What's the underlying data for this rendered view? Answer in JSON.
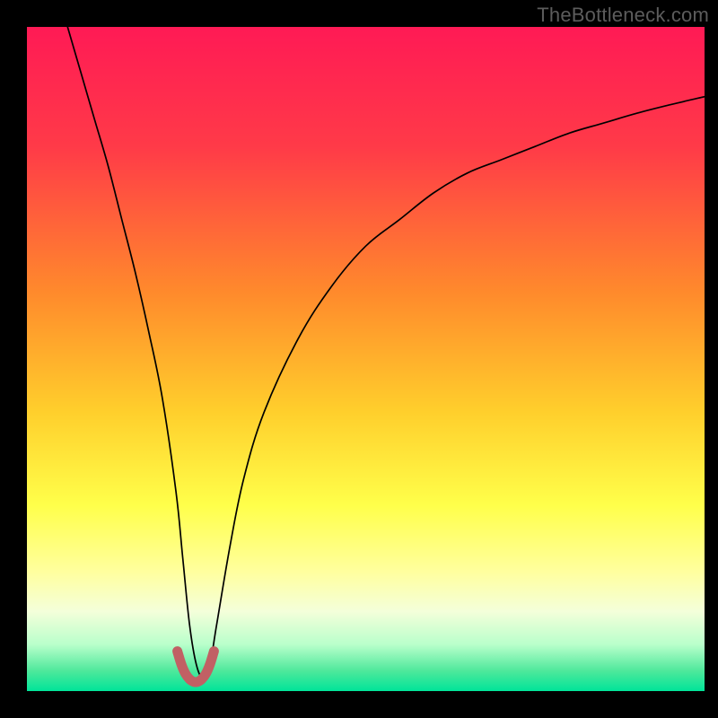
{
  "watermark": "TheBottleneck.com",
  "chart_data": {
    "type": "line",
    "title": "",
    "xlabel": "",
    "ylabel": "",
    "xlim": [
      0,
      100
    ],
    "ylim": [
      0,
      100
    ],
    "gradient_stops": [
      {
        "offset": 0,
        "color": "#ff1a55"
      },
      {
        "offset": 18,
        "color": "#ff3a48"
      },
      {
        "offset": 40,
        "color": "#ff8a2c"
      },
      {
        "offset": 58,
        "color": "#ffcf2c"
      },
      {
        "offset": 72,
        "color": "#ffff4a"
      },
      {
        "offset": 82,
        "color": "#ffff9e"
      },
      {
        "offset": 88,
        "color": "#f4ffda"
      },
      {
        "offset": 93,
        "color": "#b9ffcb"
      },
      {
        "offset": 97,
        "color": "#4de89b"
      },
      {
        "offset": 100,
        "color": "#00e499"
      }
    ],
    "series": [
      {
        "name": "bottleneck-curve",
        "color": "#000000",
        "stroke_width": 1.7,
        "x": [
          6,
          8,
          10,
          12,
          14,
          16,
          18,
          20,
          22,
          23,
          24,
          25,
          26,
          27,
          28,
          30,
          32,
          35,
          40,
          45,
          50,
          55,
          60,
          65,
          70,
          75,
          80,
          85,
          90,
          95,
          100
        ],
        "values": [
          100,
          93,
          86,
          79,
          71,
          63,
          54,
          44,
          30,
          20,
          10,
          4,
          2,
          4,
          10,
          22,
          32,
          42,
          53,
          61,
          67,
          71,
          75,
          78,
          80,
          82,
          84,
          85.5,
          87,
          88.3,
          89.5
        ]
      },
      {
        "name": "highlight-band",
        "color": "#c16064",
        "stroke_width": 11,
        "x": [
          22.2,
          22.8,
          23.4,
          24.0,
          24.6,
          25.2,
          25.8,
          26.4,
          27.0,
          27.6
        ],
        "values": [
          6.0,
          4.0,
          2.6,
          1.8,
          1.4,
          1.4,
          1.8,
          2.6,
          4.0,
          6.0
        ]
      }
    ]
  }
}
